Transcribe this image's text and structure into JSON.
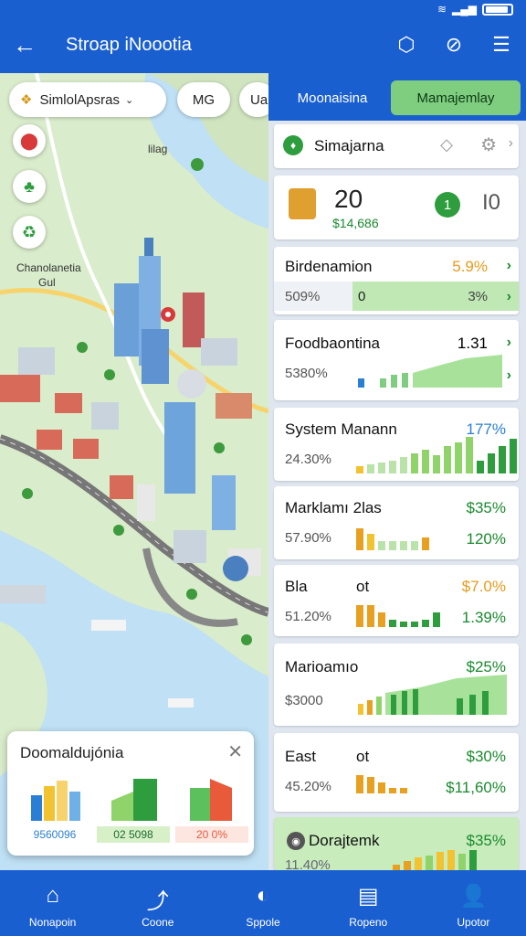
{
  "app": {
    "title": "Stroap iNoootia",
    "back_icon": "arrow-left-icon"
  },
  "appbar_actions": [
    {
      "name": "shield-icon",
      "glyph": "⬡"
    },
    {
      "name": "compass-icon",
      "glyph": "⊘"
    },
    {
      "name": "menu-list-icon",
      "glyph": "☰"
    }
  ],
  "map": {
    "chips": [
      {
        "label": "SimlolApsras",
        "has_dropdown": true
      },
      {
        "label": "MG"
      },
      {
        "label": "Ua"
      }
    ],
    "labels": [
      "lilag",
      "Chanolanetia",
      "Gul"
    ],
    "popup": {
      "title": "Doomaldujónia",
      "close_icon": "close-icon",
      "items": [
        {
          "value": "9560096",
          "color": "#2a7fd4"
        },
        {
          "value": "02 5098",
          "color": "#2e9d3e"
        },
        {
          "value": "20 0%",
          "color": "#e85a3a"
        }
      ]
    }
  },
  "panel": {
    "tabs": [
      {
        "label": "Moonaisina",
        "active": false
      },
      {
        "label": "Mamajemlay",
        "active": true
      }
    ],
    "header": {
      "title": "Simajarna"
    },
    "summary": {
      "value": "20",
      "sub": "$14,686",
      "badge": "1",
      "right": "I0"
    },
    "rows": [
      {
        "label": "Birdenamion",
        "value": "5.9%",
        "sub": "509%",
        "sub2": "0",
        "value2": "3%",
        "value_color": "#e89a1a"
      },
      {
        "label": "Foodbaontina",
        "value": "1.31",
        "sub": "5380%",
        "value_color": "#111"
      },
      {
        "label": "System Manann",
        "value": "177%",
        "sub": "24.30%",
        "value_color": "#2a7fd4"
      },
      {
        "label": "Marklamı 2las",
        "value": "$35%",
        "sub": "57.90%",
        "value2": "120%",
        "value_color": "#1a8a2e"
      },
      {
        "label": "Bla",
        "label2": "ot",
        "value": "$7.0%",
        "sub": "51.20%",
        "value2": "1.39%",
        "value_color": "#e89a1a"
      },
      {
        "label": "Marioamıo",
        "value": "$25%",
        "sub": "$3000",
        "value_color": "#1a8a2e"
      },
      {
        "label": "East",
        "label2": "ot",
        "value": "$30%",
        "sub": "45.20%",
        "value2": "$11,60%",
        "value_color": "#1a8a2e"
      },
      {
        "label": "Dorajtemk",
        "value": "$35%",
        "sub": "11.40%",
        "value_color": "#1a8a2e"
      }
    ]
  },
  "nav": [
    {
      "label": "Nonapoin",
      "icon": "home-icon",
      "glyph": "⌂"
    },
    {
      "label": "Coone",
      "icon": "chart-icon",
      "glyph": "⤴"
    },
    {
      "label": "Sppole",
      "icon": "shield-icon",
      "glyph": "◐"
    },
    {
      "label": "Ropeno",
      "icon": "document-icon",
      "glyph": "▤"
    },
    {
      "label": "Upotor",
      "icon": "user-icon",
      "glyph": "👤"
    }
  ]
}
